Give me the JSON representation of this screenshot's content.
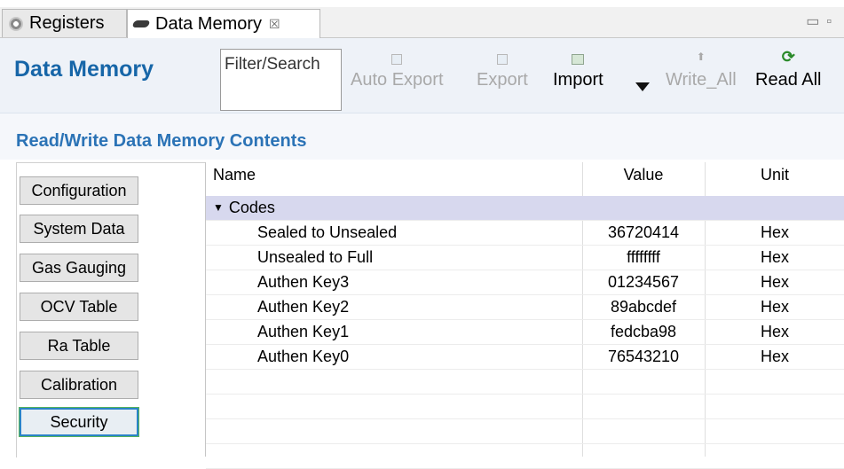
{
  "tabs": [
    {
      "label": "Registers",
      "icon": "gear-icon"
    },
    {
      "label": "Data Memory",
      "icon": "chip-icon",
      "close_glyph": "☒"
    }
  ],
  "header": {
    "title": "Data Memory",
    "filter_placeholder": "Filter/Search"
  },
  "toolbar": {
    "auto_export": "Auto Export",
    "export": "Export",
    "import": "Import",
    "write_all": "Write_All",
    "read_all": "Read All"
  },
  "section": {
    "title": "Read/Write Data Memory Contents"
  },
  "sidebar": {
    "items": [
      {
        "label": "Configuration"
      },
      {
        "label": "System Data"
      },
      {
        "label": "Gas Gauging"
      },
      {
        "label": "OCV Table"
      },
      {
        "label": "Ra Table"
      },
      {
        "label": "Calibration"
      },
      {
        "label": "Security"
      }
    ],
    "selected": "Security"
  },
  "table": {
    "headers": {
      "name": "Name",
      "value": "Value",
      "unit": "Unit"
    },
    "group": "Codes",
    "rows": [
      {
        "name": "Sealed to Unsealed",
        "value": "36720414",
        "unit": "Hex"
      },
      {
        "name": "Unsealed to Full",
        "value": "ffffffff",
        "unit": "Hex"
      },
      {
        "name": "Authen Key3",
        "value": "01234567",
        "unit": "Hex"
      },
      {
        "name": "Authen Key2",
        "value": "89abcdef",
        "unit": "Hex"
      },
      {
        "name": "Authen Key1",
        "value": "fedcba98",
        "unit": "Hex"
      },
      {
        "name": "Authen Key0",
        "value": "76543210",
        "unit": "Hex"
      }
    ]
  },
  "colors": {
    "accent": "#1766a8",
    "section": "#2b73b6",
    "group_row": "#d7d8ee"
  }
}
